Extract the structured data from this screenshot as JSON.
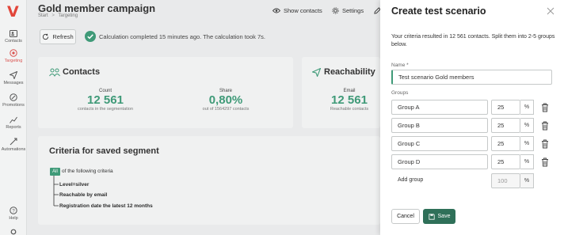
{
  "sidebar": {
    "logo": "V",
    "items": [
      {
        "label": "Contacts",
        "icon": "contacts-icon"
      },
      {
        "label": "Targeting",
        "icon": "target-icon"
      },
      {
        "label": "Messages",
        "icon": "send-icon"
      },
      {
        "label": "Promotions",
        "icon": "promotions-icon"
      },
      {
        "label": "Reports",
        "icon": "chart-icon"
      },
      {
        "label": "Automations",
        "icon": "automation-icon"
      },
      {
        "label": "Help",
        "icon": "help-icon"
      }
    ]
  },
  "header": {
    "title": "Gold member campaign",
    "breadcrumb": [
      "Start",
      ">",
      "Targeting"
    ],
    "show_contacts": "Show contacts",
    "settings": "Settings"
  },
  "toolbar": {
    "refresh": "Refresh",
    "status": "Calculation completed 15 minutes ago. The calculation took 7s."
  },
  "contacts_card": {
    "title": "Contacts",
    "count_label": "Count",
    "count_value": "12 561",
    "count_sub": "contacts in the segmentation",
    "share_label": "Share",
    "share_value": "0,80%",
    "share_sub": "out of 1564297 contacts"
  },
  "reachability_card": {
    "title": "Reachability",
    "email_label": "Email",
    "email_value": "12 561",
    "email_sub": "Reachable contacts"
  },
  "criteria": {
    "title": "Criteria for saved segment",
    "all_badge": "All",
    "intro": "of the following criteria",
    "items": [
      "Level=silver",
      "Reachable by email",
      "Registration date the latest 12 months"
    ]
  },
  "dialog": {
    "title": "Create test scenario",
    "description": "Your criteria resulted in 12 561 contacts. Split them into 2-5 groups below.",
    "name_label": "Name *",
    "name_value": "Test scenario Gold members",
    "groups_label": "Groups",
    "groups": [
      {
        "name": "Group A",
        "value": "25",
        "unit": "%"
      },
      {
        "name": "Group B",
        "value": "25",
        "unit": "%"
      },
      {
        "name": "Group C",
        "value": "25",
        "unit": "%"
      },
      {
        "name": "Group D",
        "value": "25",
        "unit": "%"
      }
    ],
    "add_group": "Add group",
    "total_value": "100",
    "total_unit": "%",
    "cancel": "Cancel",
    "save": "Save"
  },
  "colors": {
    "accent": "#3f9a78",
    "save_button": "#2f7059",
    "brand": "#e2463a"
  }
}
